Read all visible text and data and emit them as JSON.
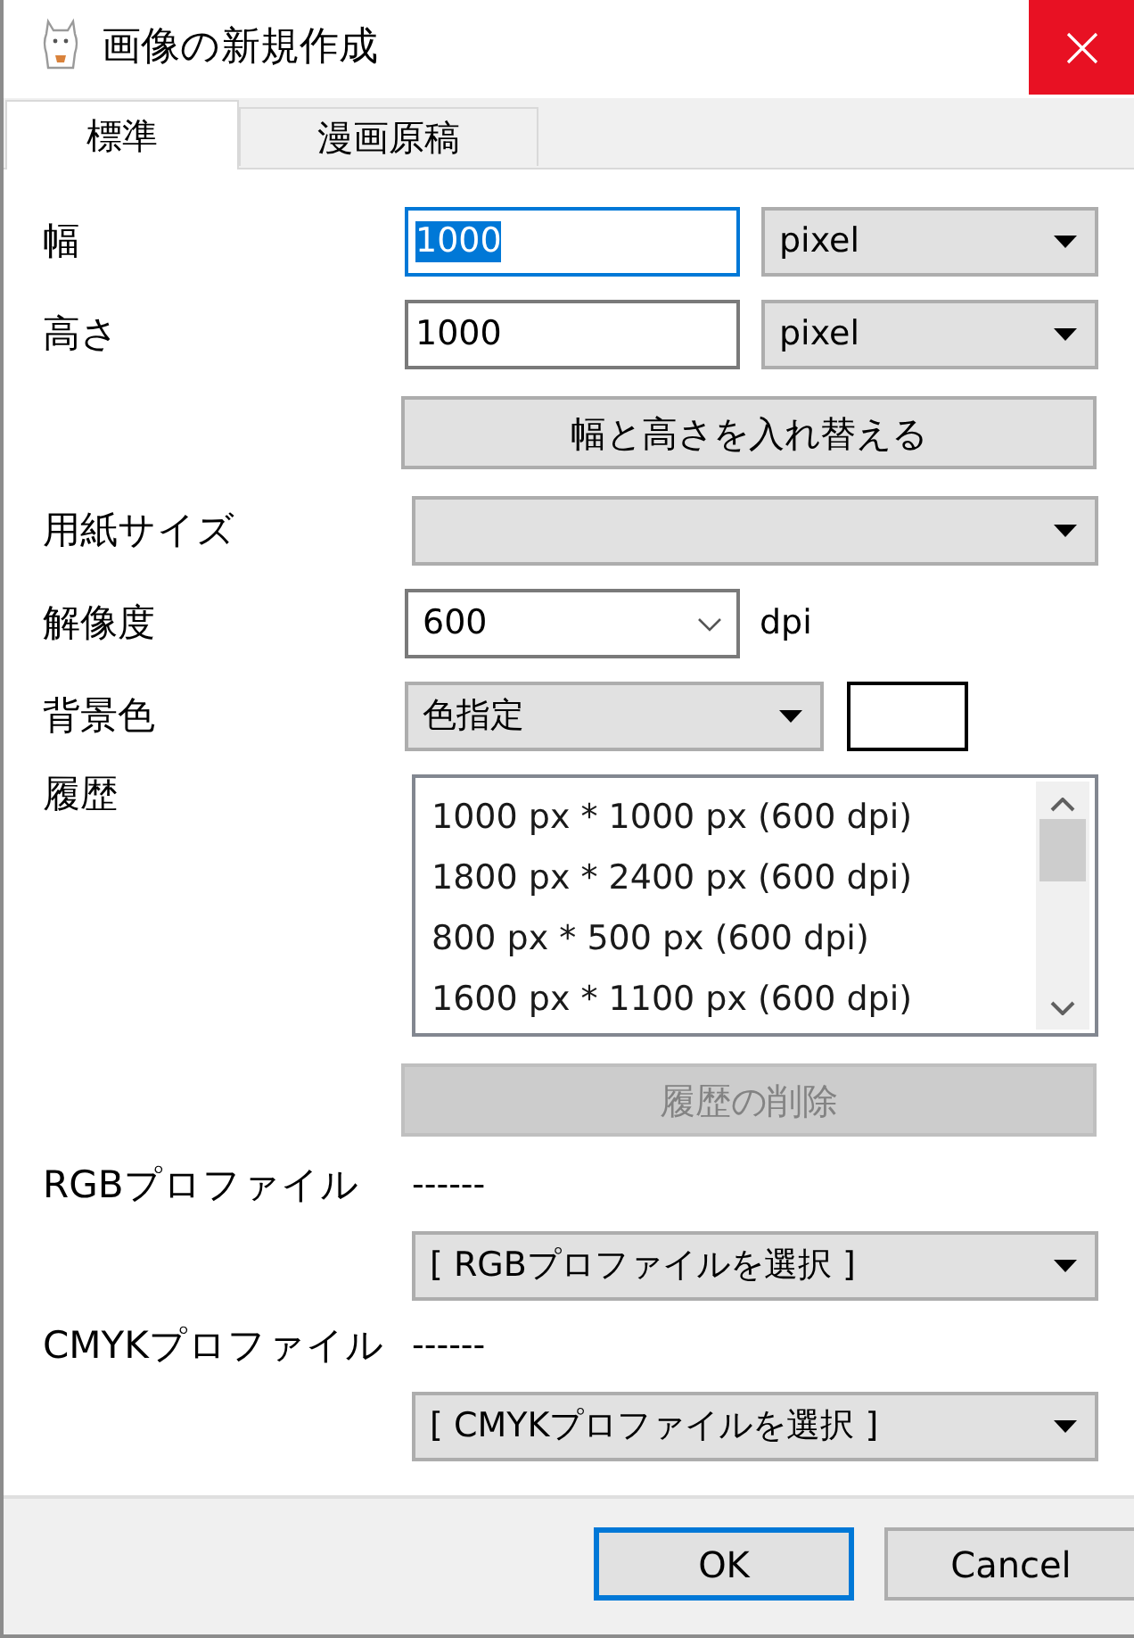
{
  "window": {
    "title": "画像の新規作成"
  },
  "tabs": [
    {
      "label": "標準",
      "selected": true
    },
    {
      "label": "漫画原稿",
      "selected": false
    }
  ],
  "form": [
    {
      "kind": "size",
      "label": "幅",
      "value": "1000",
      "focused": true,
      "unit": "pixel"
    },
    {
      "kind": "size",
      "label": "高さ",
      "value": "1000",
      "focused": false,
      "unit": "pixel"
    },
    {
      "kind": "button",
      "label": "幅と高さを入れ替える",
      "disabled": false
    },
    {
      "kind": "select",
      "label": "用紙サイズ"
    },
    {
      "kind": "combo",
      "label": "解像度",
      "value": "600",
      "unit": "dpi"
    },
    {
      "kind": "color",
      "label": "背景色",
      "value": "色指定",
      "color": "#ffffff"
    },
    {
      "kind": "list",
      "label": "履歴",
      "items": [
        "1000 px * 1000 px (600 dpi)",
        "1800 px * 2400 px (600 dpi)",
        "800 px * 500 px (600 dpi)",
        "1600 px * 1100 px (600 dpi)"
      ]
    },
    {
      "kind": "button",
      "label": "履歴の削除",
      "disabled": true
    },
    {
      "kind": "profile",
      "label": "RGBプロファイル",
      "status": "------",
      "value": "[ RGBプロファイルを選択 ]"
    },
    {
      "kind": "profile",
      "label": "CMYKプロファイル",
      "status": "------",
      "value": "[ CMYKプロファイルを選択 ]"
    }
  ],
  "buttons": [
    {
      "label": "OK",
      "default": true
    },
    {
      "label": "Cancel",
      "default": false
    }
  ]
}
